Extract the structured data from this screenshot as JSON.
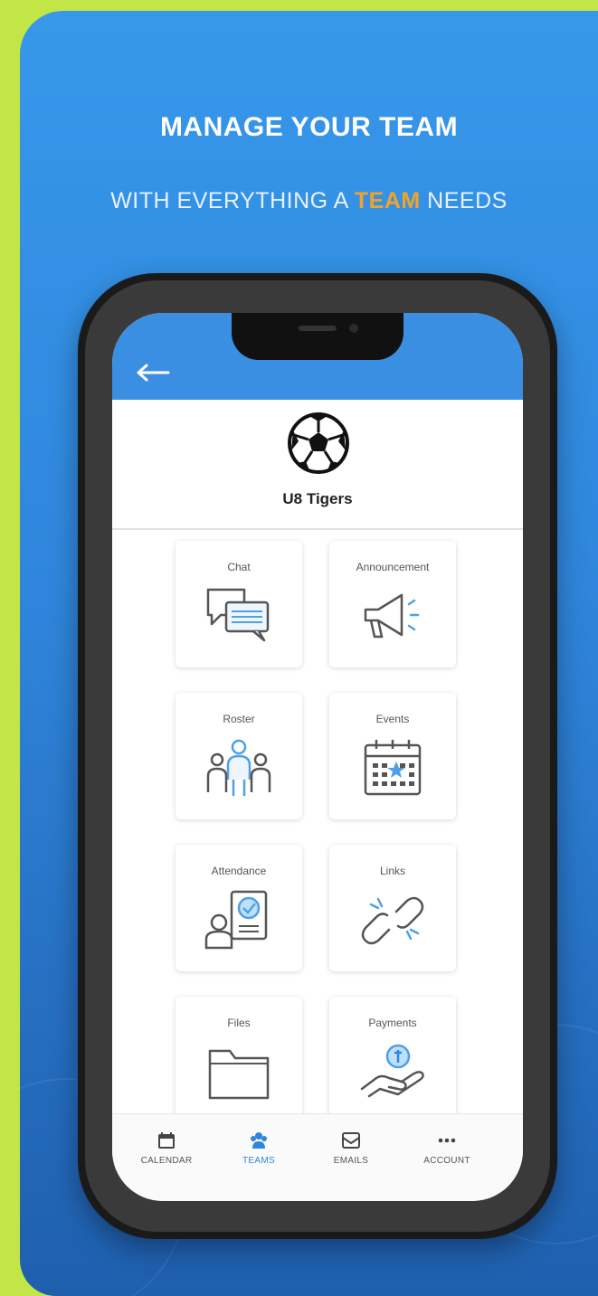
{
  "header": {
    "title": "MANAGE YOUR TEAM",
    "subtitle_before": "WITH EVERYTHING A ",
    "subtitle_highlight": "TEAM",
    "subtitle_after": " NEEDS"
  },
  "colors": {
    "accent": "#2f86dc",
    "highlight": "#f2a22a",
    "page_bg": "#c3e647"
  },
  "app": {
    "back_icon": "back-arrow-icon",
    "team_icon": "soccer-ball-icon",
    "team_name": "U8 Tigers",
    "tiles": [
      {
        "label": "Chat",
        "icon": "chat-icon"
      },
      {
        "label": "Announcement",
        "icon": "megaphone-icon"
      },
      {
        "label": "Roster",
        "icon": "roster-icon"
      },
      {
        "label": "Events",
        "icon": "calendar-icon"
      },
      {
        "label": "Attendance",
        "icon": "attendance-icon"
      },
      {
        "label": "Links",
        "icon": "link-icon"
      },
      {
        "label": "Files",
        "icon": "folder-icon"
      },
      {
        "label": "Payments",
        "icon": "payment-icon"
      }
    ],
    "tabs": [
      {
        "label": "CALENDAR",
        "icon": "calendar-tab-icon",
        "active": false
      },
      {
        "label": "TEAMS",
        "icon": "teams-tab-icon",
        "active": true
      },
      {
        "label": "EMAILS",
        "icon": "email-tab-icon",
        "active": false
      },
      {
        "label": "ACCOUNT",
        "icon": "more-icon",
        "active": false
      }
    ]
  }
}
